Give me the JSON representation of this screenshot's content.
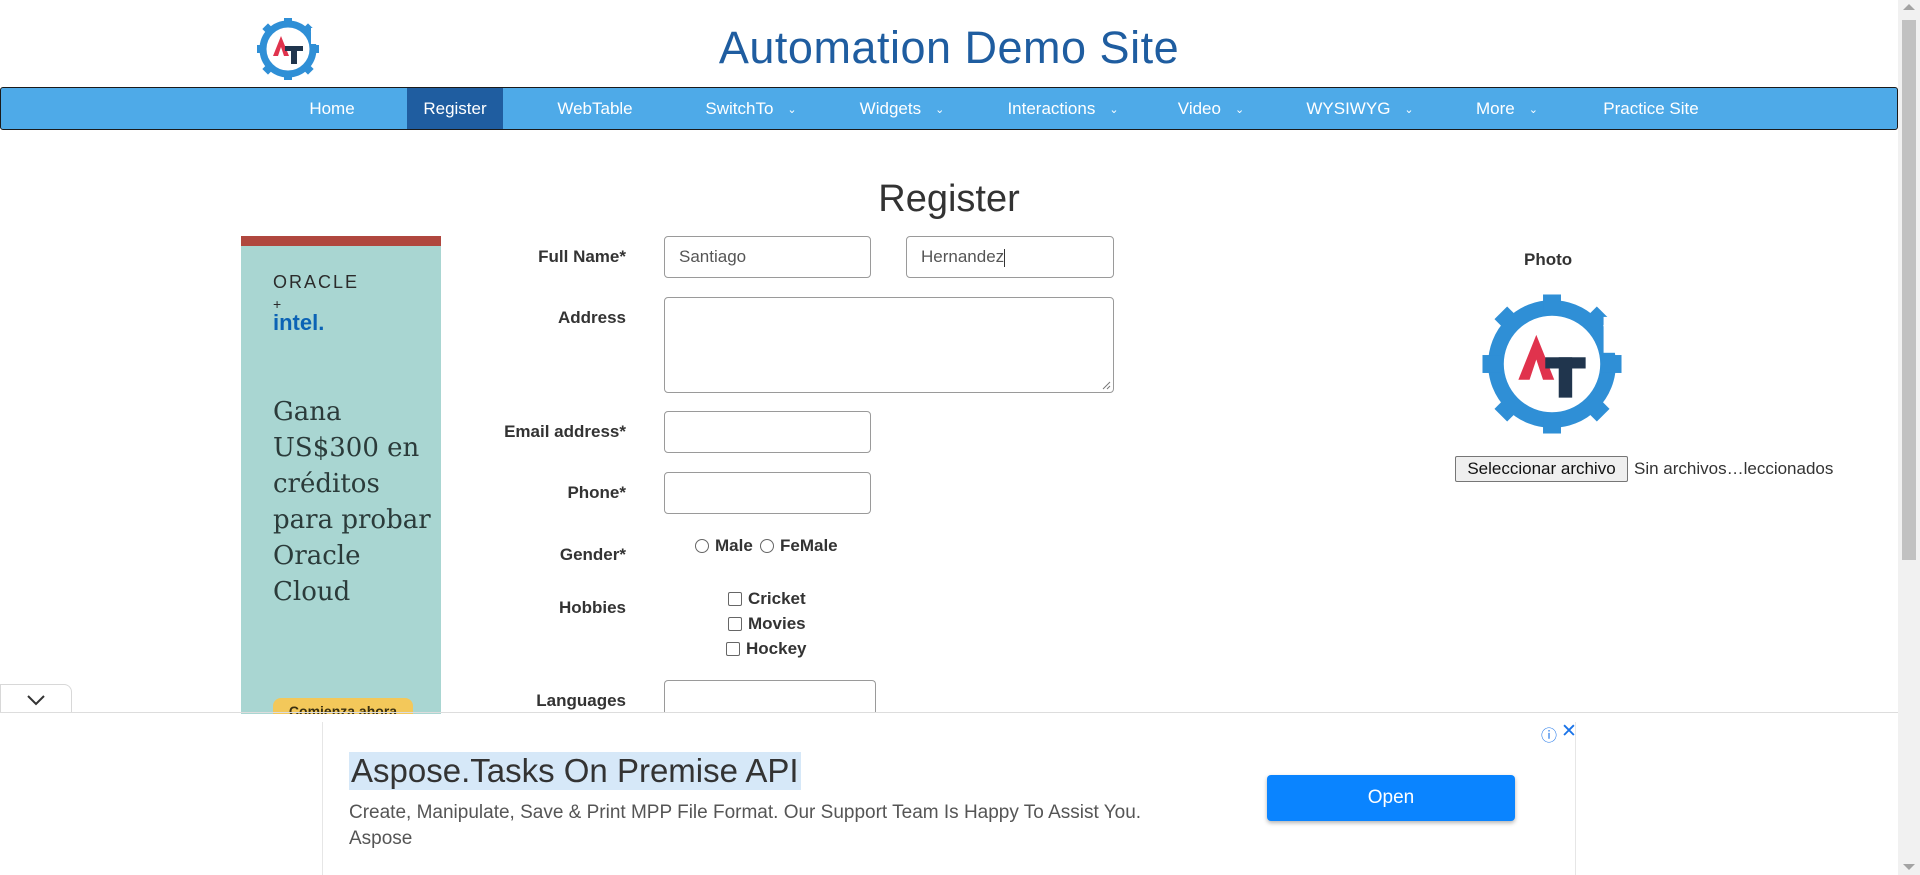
{
  "header": {
    "site_title": "Automation Demo Site"
  },
  "nav": {
    "items": [
      {
        "label": "Home",
        "dropdown": false
      },
      {
        "label": "Register",
        "dropdown": false,
        "active": true
      },
      {
        "label": "WebTable",
        "dropdown": false
      },
      {
        "label": "SwitchTo",
        "dropdown": true
      },
      {
        "label": "Widgets",
        "dropdown": true
      },
      {
        "label": "Interactions",
        "dropdown": true
      },
      {
        "label": "Video",
        "dropdown": true
      },
      {
        "label": "WYSIWYG",
        "dropdown": true
      },
      {
        "label": "More",
        "dropdown": true
      },
      {
        "label": "Practice Site",
        "dropdown": false
      }
    ]
  },
  "page": {
    "title": "Register"
  },
  "ad_left": {
    "brand1": "ORACLE",
    "plus": "+",
    "brand2": "intel.",
    "headline": "Gana US$300 en créditos para probar Oracle Cloud",
    "cta": "Comienza ahora"
  },
  "form": {
    "full_name_label": "Full Name*",
    "first_name_value": "Santiago",
    "last_name_value": "Hernandez",
    "address_label": "Address",
    "address_value": "",
    "email_label": "Email address*",
    "email_value": "",
    "phone_label": "Phone*",
    "phone_value": "",
    "gender_label": "Gender*",
    "gender_options": [
      "Male",
      "FeMale"
    ],
    "hobbies_label": "Hobbies",
    "hobbies_options": [
      "Cricket",
      "Movies",
      "Hockey"
    ],
    "languages_label": "Languages"
  },
  "photo": {
    "label": "Photo",
    "file_button": "Seleccionar archivo",
    "file_status": "Sin archivos…leccionados"
  },
  "banner": {
    "title": "Aspose.Tasks On Premise API",
    "description": "Create, Manipulate, Save & Print MPP File Format. Our Support Team Is Happy To Assist You.",
    "advertiser": "Aspose",
    "open_button": "Open",
    "info_icon": "ⓘ",
    "close_icon": "✕"
  },
  "colors": {
    "nav_bg": "#4eaae8",
    "nav_active": "#1f5da0",
    "title_blue": "#1f5da0",
    "open_button": "#0a84ff"
  }
}
